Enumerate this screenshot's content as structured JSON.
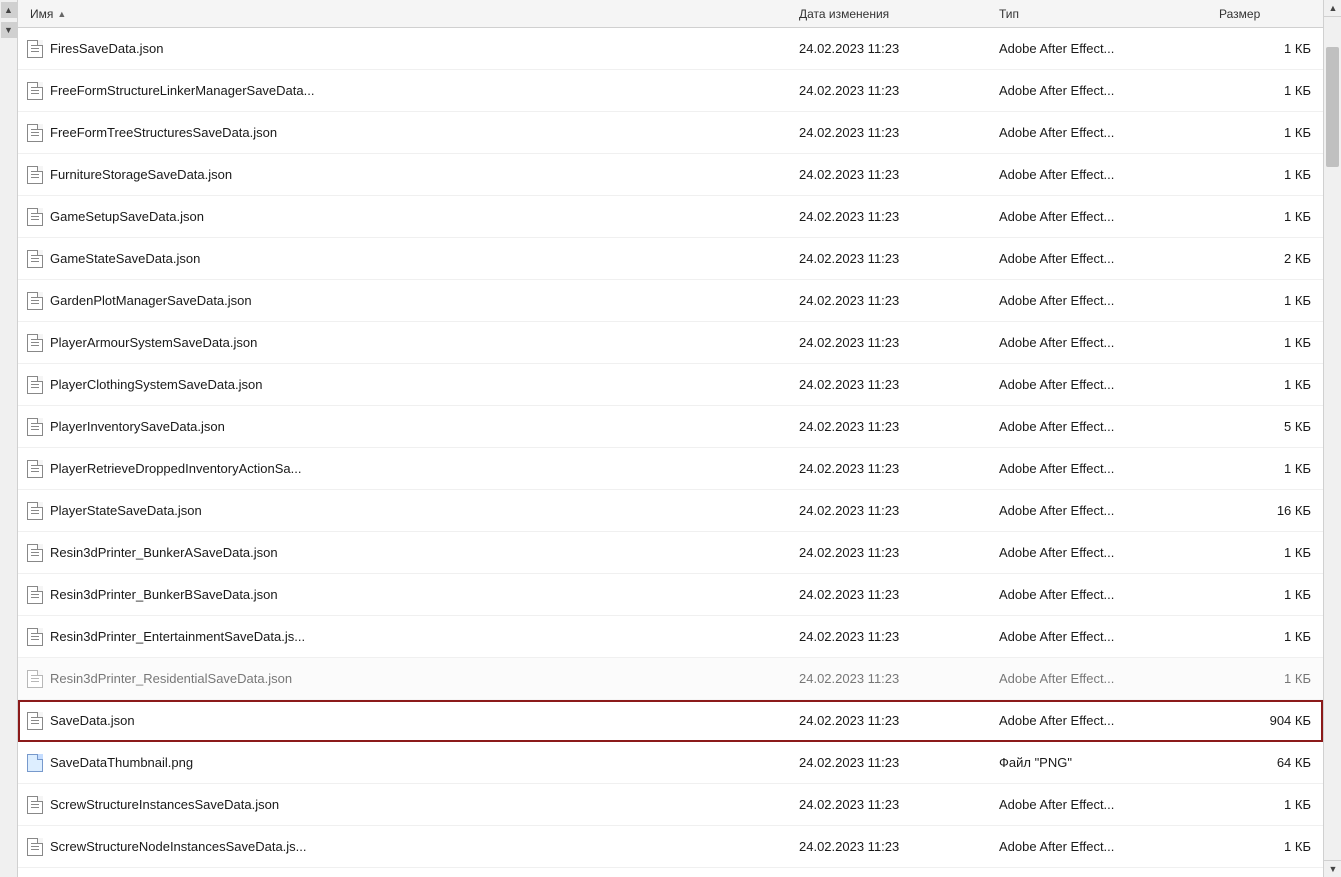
{
  "columns": {
    "name": "Имя",
    "date": "Дата изменения",
    "type": "Тип",
    "size": "Размер"
  },
  "files": [
    {
      "id": 1,
      "name": "FiresSaveData.json",
      "date": "24.02.2023 11:23",
      "type": "Adobe After Effect...",
      "size": "1 КБ",
      "iconType": "json",
      "highlighted": false,
      "faded": false
    },
    {
      "id": 2,
      "name": "FreeFormStructureLinkerManagerSaveData...",
      "date": "24.02.2023 11:23",
      "type": "Adobe After Effect...",
      "size": "1 КБ",
      "iconType": "json",
      "highlighted": false,
      "faded": false
    },
    {
      "id": 3,
      "name": "FreeFormTreeStructuresSaveData.json",
      "date": "24.02.2023 11:23",
      "type": "Adobe After Effect...",
      "size": "1 КБ",
      "iconType": "json",
      "highlighted": false,
      "faded": false
    },
    {
      "id": 4,
      "name": "FurnitureStorageSaveData.json",
      "date": "24.02.2023 11:23",
      "type": "Adobe After Effect...",
      "size": "1 КБ",
      "iconType": "json",
      "highlighted": false,
      "faded": false
    },
    {
      "id": 5,
      "name": "GameSetupSaveData.json",
      "date": "24.02.2023 11:23",
      "type": "Adobe After Effect...",
      "size": "1 КБ",
      "iconType": "json",
      "highlighted": false,
      "faded": false
    },
    {
      "id": 6,
      "name": "GameStateSaveData.json",
      "date": "24.02.2023 11:23",
      "type": "Adobe After Effect...",
      "size": "2 КБ",
      "iconType": "json",
      "highlighted": false,
      "faded": false
    },
    {
      "id": 7,
      "name": "GardenPlotManagerSaveData.json",
      "date": "24.02.2023 11:23",
      "type": "Adobe After Effect...",
      "size": "1 КБ",
      "iconType": "json",
      "highlighted": false,
      "faded": false
    },
    {
      "id": 8,
      "name": "PlayerArmourSystemSaveData.json",
      "date": "24.02.2023 11:23",
      "type": "Adobe After Effect...",
      "size": "1 КБ",
      "iconType": "json",
      "highlighted": false,
      "faded": false
    },
    {
      "id": 9,
      "name": "PlayerClothingSystemSaveData.json",
      "date": "24.02.2023 11:23",
      "type": "Adobe After Effect...",
      "size": "1 КБ",
      "iconType": "json",
      "highlighted": false,
      "faded": false
    },
    {
      "id": 10,
      "name": "PlayerInventorySaveData.json",
      "date": "24.02.2023 11:23",
      "type": "Adobe After Effect...",
      "size": "5 КБ",
      "iconType": "json",
      "highlighted": false,
      "faded": false
    },
    {
      "id": 11,
      "name": "PlayerRetrieveDroppedInventoryActionSa...",
      "date": "24.02.2023 11:23",
      "type": "Adobe After Effect...",
      "size": "1 КБ",
      "iconType": "json",
      "highlighted": false,
      "faded": false
    },
    {
      "id": 12,
      "name": "PlayerStateSaveData.json",
      "date": "24.02.2023 11:23",
      "type": "Adobe After Effect...",
      "size": "16 КБ",
      "iconType": "json",
      "highlighted": false,
      "faded": false
    },
    {
      "id": 13,
      "name": "Resin3dPrinter_BunkerASaveData.json",
      "date": "24.02.2023 11:23",
      "type": "Adobe After Effect...",
      "size": "1 КБ",
      "iconType": "json",
      "highlighted": false,
      "faded": false
    },
    {
      "id": 14,
      "name": "Resin3dPrinter_BunkerBSaveData.json",
      "date": "24.02.2023 11:23",
      "type": "Adobe After Effect...",
      "size": "1 КБ",
      "iconType": "json",
      "highlighted": false,
      "faded": false
    },
    {
      "id": 15,
      "name": "Resin3dPrinter_EntertainmentSaveData.js...",
      "date": "24.02.2023 11:23",
      "type": "Adobe After Effect...",
      "size": "1 КБ",
      "iconType": "json",
      "highlighted": false,
      "faded": false
    },
    {
      "id": 16,
      "name": "Resin3dPrinter_ResidentialSaveData.json",
      "date": "24.02.2023 11:23",
      "type": "Adobe After Effect...",
      "size": "1 КБ",
      "iconType": "json",
      "highlighted": false,
      "faded": true
    },
    {
      "id": 17,
      "name": "SaveData.json",
      "date": "24.02.2023 11:23",
      "type": "Adobe After Effect...",
      "size": "904 КБ",
      "iconType": "json",
      "highlighted": true,
      "faded": false
    },
    {
      "id": 18,
      "name": "SaveDataThumbnail.png",
      "date": "24.02.2023 11:23",
      "type": "Файл \"PNG\"",
      "size": "64 КБ",
      "iconType": "png",
      "highlighted": false,
      "faded": false
    },
    {
      "id": 19,
      "name": "ScrewStructureInstancesSaveData.json",
      "date": "24.02.2023 11:23",
      "type": "Adobe After Effect...",
      "size": "1 КБ",
      "iconType": "json",
      "highlighted": false,
      "faded": false
    },
    {
      "id": 20,
      "name": "ScrewStructureNodeInstancesSaveData.js...",
      "date": "24.02.2023 11:23",
      "type": "Adobe After Effect...",
      "size": "1 КБ",
      "iconType": "json",
      "highlighted": false,
      "faded": false
    }
  ]
}
